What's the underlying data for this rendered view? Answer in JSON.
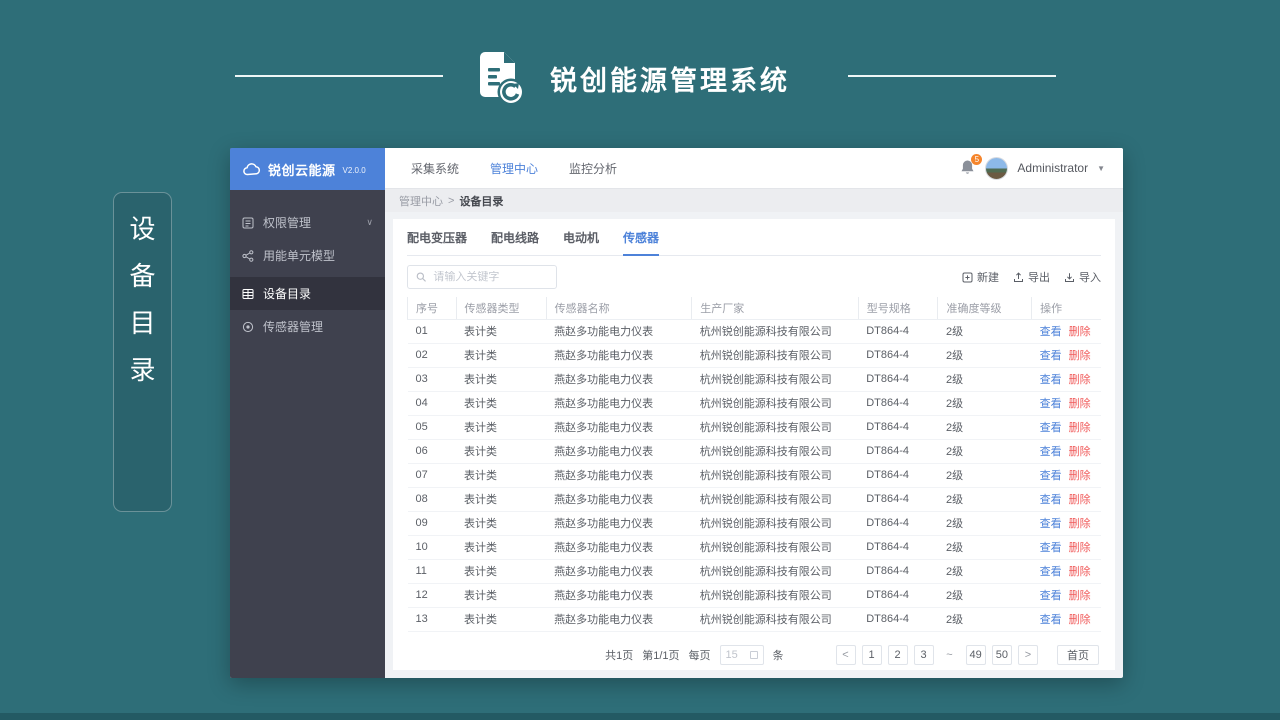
{
  "colors": {
    "accent": "#4d82d9",
    "danger": "#f05a5a",
    "page_bg": "#2e6e78",
    "sidebar_bg": "#3f414e",
    "badge": "#f5852c"
  },
  "header": {
    "title": "锐创能源管理系统"
  },
  "side_label": {
    "chars": [
      "设",
      "备",
      "目",
      "录"
    ]
  },
  "sidebar": {
    "product": "锐创云能源",
    "version": "V2.0.0",
    "items": [
      {
        "label": "权限管理"
      },
      {
        "label": "用能单元模型"
      },
      {
        "label": "设备目录"
      },
      {
        "label": "传感器管理"
      }
    ]
  },
  "topnav": {
    "items": [
      {
        "label": "采集系统"
      },
      {
        "label": "管理中心"
      },
      {
        "label": "监控分析"
      }
    ],
    "notification_count": "5",
    "username": "Administrator"
  },
  "breadcrumb": {
    "parent": "管理中心",
    "separator": ">",
    "current": "设备目录"
  },
  "tabs": [
    {
      "label": "配电变压器"
    },
    {
      "label": "配电线路"
    },
    {
      "label": "电动机"
    },
    {
      "label": "传感器"
    }
  ],
  "toolbar": {
    "search_placeholder": "请输入关键字",
    "new_label": "新建",
    "export_label": "导出",
    "import_label": "导入"
  },
  "table": {
    "headers": [
      "序号",
      "传感器类型",
      "传感器名称",
      "生产厂家",
      "型号规格",
      "准确度等级",
      "操作"
    ],
    "view_label": "查看",
    "delete_label": "删除",
    "rows": [
      {
        "no": "01",
        "type": "表计类",
        "name": "燕赵多功能电力仪表",
        "manufacturer": "杭州锐创能源科技有限公司",
        "model": "DT864-4",
        "accuracy": "2级"
      },
      {
        "no": "02",
        "type": "表计类",
        "name": "燕赵多功能电力仪表",
        "manufacturer": "杭州锐创能源科技有限公司",
        "model": "DT864-4",
        "accuracy": "2级"
      },
      {
        "no": "03",
        "type": "表计类",
        "name": "燕赵多功能电力仪表",
        "manufacturer": "杭州锐创能源科技有限公司",
        "model": "DT864-4",
        "accuracy": "2级"
      },
      {
        "no": "04",
        "type": "表计类",
        "name": "燕赵多功能电力仪表",
        "manufacturer": "杭州锐创能源科技有限公司",
        "model": "DT864-4",
        "accuracy": "2级"
      },
      {
        "no": "05",
        "type": "表计类",
        "name": "燕赵多功能电力仪表",
        "manufacturer": "杭州锐创能源科技有限公司",
        "model": "DT864-4",
        "accuracy": "2级"
      },
      {
        "no": "06",
        "type": "表计类",
        "name": "燕赵多功能电力仪表",
        "manufacturer": "杭州锐创能源科技有限公司",
        "model": "DT864-4",
        "accuracy": "2级"
      },
      {
        "no": "07",
        "type": "表计类",
        "name": "燕赵多功能电力仪表",
        "manufacturer": "杭州锐创能源科技有限公司",
        "model": "DT864-4",
        "accuracy": "2级"
      },
      {
        "no": "08",
        "type": "表计类",
        "name": "燕赵多功能电力仪表",
        "manufacturer": "杭州锐创能源科技有限公司",
        "model": "DT864-4",
        "accuracy": "2级"
      },
      {
        "no": "09",
        "type": "表计类",
        "name": "燕赵多功能电力仪表",
        "manufacturer": "杭州锐创能源科技有限公司",
        "model": "DT864-4",
        "accuracy": "2级"
      },
      {
        "no": "10",
        "type": "表计类",
        "name": "燕赵多功能电力仪表",
        "manufacturer": "杭州锐创能源科技有限公司",
        "model": "DT864-4",
        "accuracy": "2级"
      },
      {
        "no": "11",
        "type": "表计类",
        "name": "燕赵多功能电力仪表",
        "manufacturer": "杭州锐创能源科技有限公司",
        "model": "DT864-4",
        "accuracy": "2级"
      },
      {
        "no": "12",
        "type": "表计类",
        "name": "燕赵多功能电力仪表",
        "manufacturer": "杭州锐创能源科技有限公司",
        "model": "DT864-4",
        "accuracy": "2级"
      },
      {
        "no": "13",
        "type": "表计类",
        "name": "燕赵多功能电力仪表",
        "manufacturer": "杭州锐创能源科技有限公司",
        "model": "DT864-4",
        "accuracy": "2级"
      }
    ]
  },
  "pagination": {
    "total_pages": "共1页",
    "current_page": "第1/1页",
    "per_page_label": "每页",
    "per_page_value": "15",
    "unit": "条",
    "prev": "<",
    "next": ">",
    "pages": [
      "1",
      "2",
      "3",
      "~",
      "49",
      "50"
    ],
    "home": "首页"
  }
}
